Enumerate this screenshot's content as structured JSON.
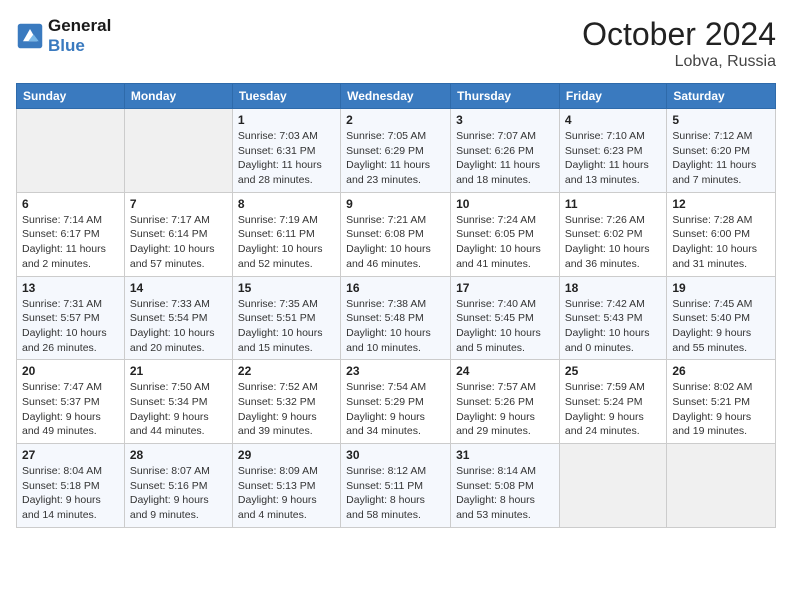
{
  "header": {
    "logo_line1": "General",
    "logo_line2": "Blue",
    "month": "October 2024",
    "location": "Lobva, Russia"
  },
  "columns": [
    "Sunday",
    "Monday",
    "Tuesday",
    "Wednesday",
    "Thursday",
    "Friday",
    "Saturday"
  ],
  "weeks": [
    [
      {
        "day": "",
        "sunrise": "",
        "sunset": "",
        "daylight": ""
      },
      {
        "day": "",
        "sunrise": "",
        "sunset": "",
        "daylight": ""
      },
      {
        "day": "1",
        "sunrise": "Sunrise: 7:03 AM",
        "sunset": "Sunset: 6:31 PM",
        "daylight": "Daylight: 11 hours and 28 minutes."
      },
      {
        "day": "2",
        "sunrise": "Sunrise: 7:05 AM",
        "sunset": "Sunset: 6:29 PM",
        "daylight": "Daylight: 11 hours and 23 minutes."
      },
      {
        "day": "3",
        "sunrise": "Sunrise: 7:07 AM",
        "sunset": "Sunset: 6:26 PM",
        "daylight": "Daylight: 11 hours and 18 minutes."
      },
      {
        "day": "4",
        "sunrise": "Sunrise: 7:10 AM",
        "sunset": "Sunset: 6:23 PM",
        "daylight": "Daylight: 11 hours and 13 minutes."
      },
      {
        "day": "5",
        "sunrise": "Sunrise: 7:12 AM",
        "sunset": "Sunset: 6:20 PM",
        "daylight": "Daylight: 11 hours and 7 minutes."
      }
    ],
    [
      {
        "day": "6",
        "sunrise": "Sunrise: 7:14 AM",
        "sunset": "Sunset: 6:17 PM",
        "daylight": "Daylight: 11 hours and 2 minutes."
      },
      {
        "day": "7",
        "sunrise": "Sunrise: 7:17 AM",
        "sunset": "Sunset: 6:14 PM",
        "daylight": "Daylight: 10 hours and 57 minutes."
      },
      {
        "day": "8",
        "sunrise": "Sunrise: 7:19 AM",
        "sunset": "Sunset: 6:11 PM",
        "daylight": "Daylight: 10 hours and 52 minutes."
      },
      {
        "day": "9",
        "sunrise": "Sunrise: 7:21 AM",
        "sunset": "Sunset: 6:08 PM",
        "daylight": "Daylight: 10 hours and 46 minutes."
      },
      {
        "day": "10",
        "sunrise": "Sunrise: 7:24 AM",
        "sunset": "Sunset: 6:05 PM",
        "daylight": "Daylight: 10 hours and 41 minutes."
      },
      {
        "day": "11",
        "sunrise": "Sunrise: 7:26 AM",
        "sunset": "Sunset: 6:02 PM",
        "daylight": "Daylight: 10 hours and 36 minutes."
      },
      {
        "day": "12",
        "sunrise": "Sunrise: 7:28 AM",
        "sunset": "Sunset: 6:00 PM",
        "daylight": "Daylight: 10 hours and 31 minutes."
      }
    ],
    [
      {
        "day": "13",
        "sunrise": "Sunrise: 7:31 AM",
        "sunset": "Sunset: 5:57 PM",
        "daylight": "Daylight: 10 hours and 26 minutes."
      },
      {
        "day": "14",
        "sunrise": "Sunrise: 7:33 AM",
        "sunset": "Sunset: 5:54 PM",
        "daylight": "Daylight: 10 hours and 20 minutes."
      },
      {
        "day": "15",
        "sunrise": "Sunrise: 7:35 AM",
        "sunset": "Sunset: 5:51 PM",
        "daylight": "Daylight: 10 hours and 15 minutes."
      },
      {
        "day": "16",
        "sunrise": "Sunrise: 7:38 AM",
        "sunset": "Sunset: 5:48 PM",
        "daylight": "Daylight: 10 hours and 10 minutes."
      },
      {
        "day": "17",
        "sunrise": "Sunrise: 7:40 AM",
        "sunset": "Sunset: 5:45 PM",
        "daylight": "Daylight: 10 hours and 5 minutes."
      },
      {
        "day": "18",
        "sunrise": "Sunrise: 7:42 AM",
        "sunset": "Sunset: 5:43 PM",
        "daylight": "Daylight: 10 hours and 0 minutes."
      },
      {
        "day": "19",
        "sunrise": "Sunrise: 7:45 AM",
        "sunset": "Sunset: 5:40 PM",
        "daylight": "Daylight: 9 hours and 55 minutes."
      }
    ],
    [
      {
        "day": "20",
        "sunrise": "Sunrise: 7:47 AM",
        "sunset": "Sunset: 5:37 PM",
        "daylight": "Daylight: 9 hours and 49 minutes."
      },
      {
        "day": "21",
        "sunrise": "Sunrise: 7:50 AM",
        "sunset": "Sunset: 5:34 PM",
        "daylight": "Daylight: 9 hours and 44 minutes."
      },
      {
        "day": "22",
        "sunrise": "Sunrise: 7:52 AM",
        "sunset": "Sunset: 5:32 PM",
        "daylight": "Daylight: 9 hours and 39 minutes."
      },
      {
        "day": "23",
        "sunrise": "Sunrise: 7:54 AM",
        "sunset": "Sunset: 5:29 PM",
        "daylight": "Daylight: 9 hours and 34 minutes."
      },
      {
        "day": "24",
        "sunrise": "Sunrise: 7:57 AM",
        "sunset": "Sunset: 5:26 PM",
        "daylight": "Daylight: 9 hours and 29 minutes."
      },
      {
        "day": "25",
        "sunrise": "Sunrise: 7:59 AM",
        "sunset": "Sunset: 5:24 PM",
        "daylight": "Daylight: 9 hours and 24 minutes."
      },
      {
        "day": "26",
        "sunrise": "Sunrise: 8:02 AM",
        "sunset": "Sunset: 5:21 PM",
        "daylight": "Daylight: 9 hours and 19 minutes."
      }
    ],
    [
      {
        "day": "27",
        "sunrise": "Sunrise: 8:04 AM",
        "sunset": "Sunset: 5:18 PM",
        "daylight": "Daylight: 9 hours and 14 minutes."
      },
      {
        "day": "28",
        "sunrise": "Sunrise: 8:07 AM",
        "sunset": "Sunset: 5:16 PM",
        "daylight": "Daylight: 9 hours and 9 minutes."
      },
      {
        "day": "29",
        "sunrise": "Sunrise: 8:09 AM",
        "sunset": "Sunset: 5:13 PM",
        "daylight": "Daylight: 9 hours and 4 minutes."
      },
      {
        "day": "30",
        "sunrise": "Sunrise: 8:12 AM",
        "sunset": "Sunset: 5:11 PM",
        "daylight": "Daylight: 8 hours and 58 minutes."
      },
      {
        "day": "31",
        "sunrise": "Sunrise: 8:14 AM",
        "sunset": "Sunset: 5:08 PM",
        "daylight": "Daylight: 8 hours and 53 minutes."
      },
      {
        "day": "",
        "sunrise": "",
        "sunset": "",
        "daylight": ""
      },
      {
        "day": "",
        "sunrise": "",
        "sunset": "",
        "daylight": ""
      }
    ]
  ]
}
